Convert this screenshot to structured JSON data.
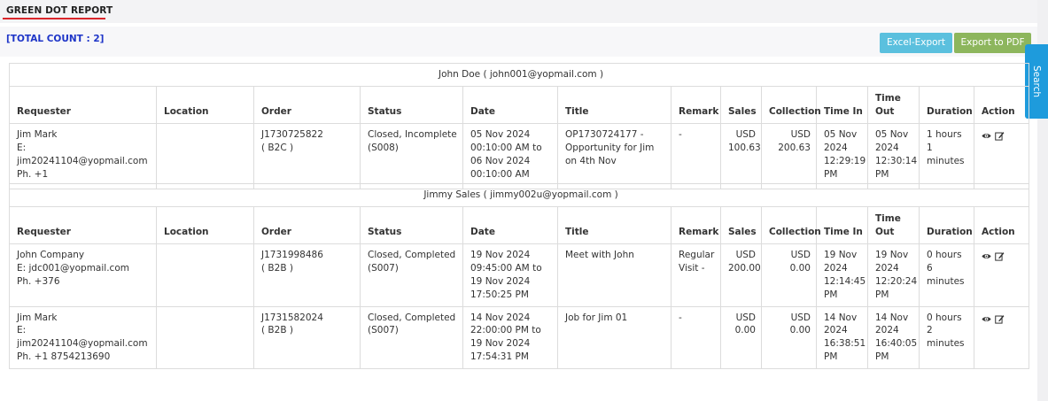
{
  "page": {
    "title": "GREEN DOT REPORT",
    "total_count": "[TOTAL COUNT : 2]"
  },
  "toolbar": {
    "excel_label": "Excel-Export",
    "pdf_label": "Export to PDF",
    "search_label": "Search"
  },
  "columns": [
    "Requester",
    "Location",
    "Order",
    "Status",
    "Date",
    "Title",
    "Remark",
    "Sales",
    "Collection",
    "Time In",
    "Time Out",
    "Duration",
    "Action"
  ],
  "groups": [
    {
      "header": "John Doe ( john001@yopmail.com )",
      "rows": [
        {
          "requester_name": "Jim Mark",
          "requester_email": "E: jim20241104@yopmail.com",
          "requester_phone": "Ph. +1",
          "location": "",
          "order_no": "J1730725822",
          "order_type": "( B2C )",
          "status": "Closed, Incomplete (S008)",
          "date": "05 Nov 2024 00:10:00 AM to 06 Nov 2024 00:10:00 AM",
          "title": "OP1730724177 - Opportunity for Jim on 4th Nov",
          "remark": "-",
          "sales": "USD 100.63",
          "collection": "USD 200.63",
          "time_in": "05 Nov 2024 12:29:19 PM",
          "time_out": "05 Nov 2024 12:30:14 PM",
          "duration": "1 hours 1 minutes"
        }
      ]
    },
    {
      "header": "Jimmy Sales ( jimmy002u@yopmail.com )",
      "rows": [
        {
          "requester_name": "John Company",
          "requester_email": "E: jdc001@yopmail.com",
          "requester_phone": "Ph. +376",
          "location": "",
          "order_no": "J1731998486",
          "order_type": "( B2B )",
          "status": "Closed, Completed (S007)",
          "date": "19 Nov 2024 09:45:00 AM to 19 Nov 2024 17:50:25 PM",
          "title": "Meet with John",
          "remark": "Regular Visit -",
          "sales": "USD 200.00",
          "collection": "USD 0.00",
          "time_in": "19 Nov 2024 12:14:45 PM",
          "time_out": "19 Nov 2024 12:20:24 PM",
          "duration": "0 hours 6 minutes"
        },
        {
          "requester_name": "Jim Mark",
          "requester_email": "E: jim20241104@yopmail.com",
          "requester_phone": "Ph. +1 8754213690",
          "location": "",
          "order_no": "J1731582024",
          "order_type": "( B2B )",
          "status": "Closed, Completed (S007)",
          "date": "14 Nov 2024 22:00:00 PM to 19 Nov 2024 17:54:31 PM",
          "title": "Job for Jim 01",
          "remark": "-",
          "sales": "USD 0.00",
          "collection": "USD 0.00",
          "time_in": "14 Nov 2024 16:38:51 PM",
          "time_out": "14 Nov 2024 16:40:05 PM",
          "duration": "0 hours 2 minutes"
        }
      ]
    }
  ],
  "icons": {
    "view": "eye-icon",
    "edit": "edit-icon"
  },
  "colors": {
    "title_underline": "#d9252a",
    "total_count": "#1e35c8",
    "excel_button": "#5bc0de",
    "pdf_button": "#8db65d",
    "search_tab": "#1e9bdc"
  }
}
